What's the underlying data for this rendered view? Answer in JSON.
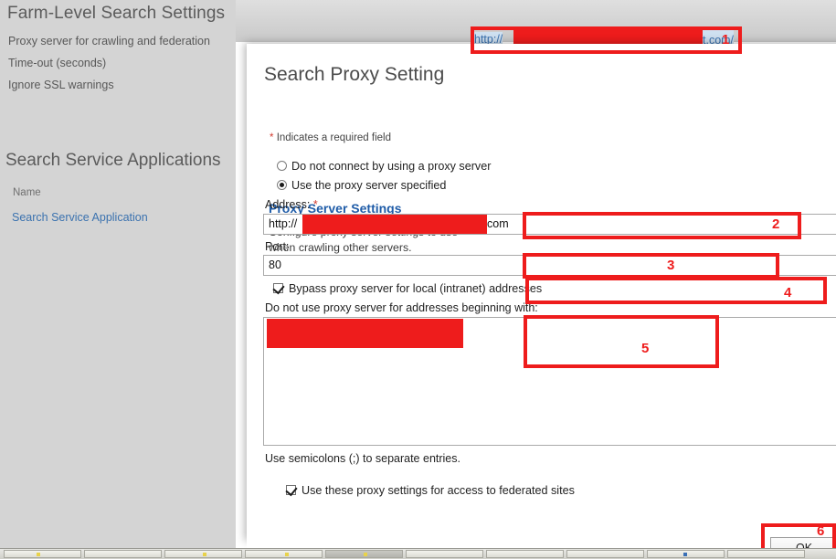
{
  "background_page": {
    "farm_title": "Farm-Level Search Settings",
    "farm_rows": [
      "Proxy server for crawling and federation",
      "Time-out (seconds)",
      "Ignore SSL warnings"
    ],
    "service_apps_title": "Search Service Applications",
    "service_apps_column_header": "Name",
    "service_app_link": "Search Service Application"
  },
  "browser": {
    "url_prefix": "http://",
    "url_suffix": "t.com/",
    "url_redacted": true
  },
  "dialog": {
    "title": "Search Proxy Setting",
    "required_field_note": "Indicates a required field",
    "required_star": "*",
    "section": {
      "heading": "Proxy Server Settings",
      "description": "Configure proxy server settings to use when crawling other servers."
    },
    "radios": [
      {
        "label": "Do not connect by using a proxy server",
        "selected": false
      },
      {
        "label": "Use the proxy server specified",
        "selected": true
      }
    ],
    "address": {
      "label": "Address:",
      "required_marker": "*",
      "value_prefix": "http://",
      "value_suffix": "com",
      "redacted": true
    },
    "port": {
      "label": "Port:",
      "value": "80"
    },
    "bypass_local": {
      "label": "Bypass proxy server for local (intranet) addresses",
      "checked": true
    },
    "exceptions": {
      "label": "Do not use proxy server for addresses beginning with:",
      "value": "",
      "redacted": true,
      "hint": "Use semicolons (;) to separate entries."
    },
    "federated": {
      "label": "Use these proxy settings for access to federated sites",
      "checked": true
    },
    "ok_button": "OK"
  },
  "annotations": [
    {
      "number": "1",
      "target": "url-bar"
    },
    {
      "number": "2",
      "target": "address-field"
    },
    {
      "number": "3",
      "target": "port-field"
    },
    {
      "number": "4",
      "target": "bypass-local-checkbox"
    },
    {
      "number": "5",
      "target": "exceptions-textarea"
    },
    {
      "number": "6",
      "target": "ok-button"
    }
  ],
  "colors": {
    "annotation_red": "#ee1c1c",
    "link_blue": "#3b72af",
    "section_heading_blue": "#1f5ca8",
    "required_red": "#d23b2f"
  }
}
